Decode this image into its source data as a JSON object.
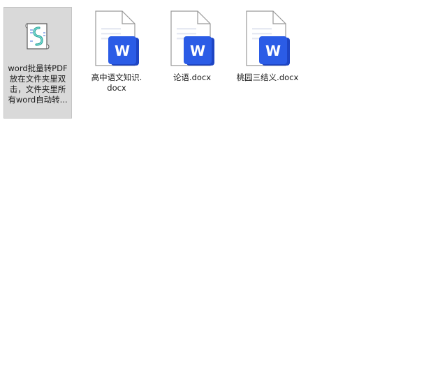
{
  "files": [
    {
      "label_lines": [
        "word批量转PDF",
        "放在文件夹里双",
        "击，文件夹里所",
        "有word自动转..."
      ],
      "icon": "script-file-icon",
      "selected": true
    },
    {
      "label_lines": [
        "高中语文知识.",
        "docx"
      ],
      "icon": "word-doc-icon",
      "selected": false
    },
    {
      "label_lines": [
        "论语.docx"
      ],
      "icon": "word-doc-icon",
      "selected": false
    },
    {
      "label_lines": [
        "桃园三结义.docx"
      ],
      "icon": "word-doc-icon",
      "selected": false
    }
  ],
  "word_badge_letter": "W",
  "colors": {
    "word_blue": "#2b5ce6",
    "word_blue_dark": "#1e45c4",
    "selection_bg": "#d9d9d9"
  }
}
